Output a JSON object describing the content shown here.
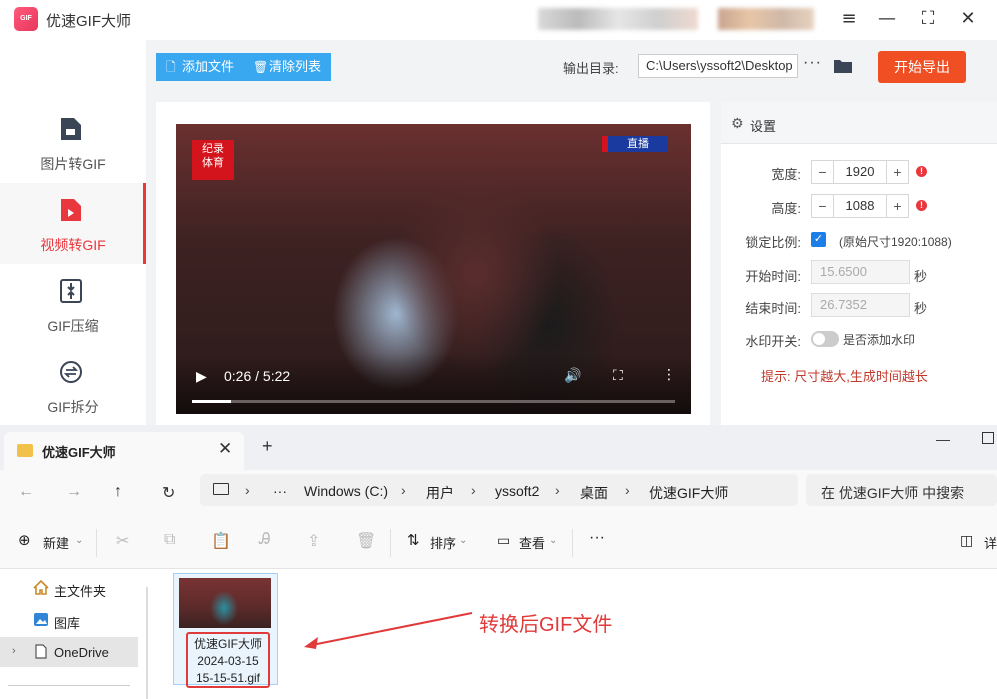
{
  "app": {
    "title": "优速GIF大师",
    "logo_text": "GIF",
    "window_controls": [
      "menu-icon",
      "minimize-icon",
      "maximize-icon",
      "close-icon"
    ],
    "sidebar": {
      "items": [
        {
          "label": "图片转GIF",
          "icon": "image-file-icon",
          "active": false
        },
        {
          "label": "视频转GIF",
          "icon": "video-file-icon",
          "active": true
        },
        {
          "label": "GIF压缩",
          "icon": "compress-icon",
          "active": false
        },
        {
          "label": "GIF拆分",
          "icon": "split-icon",
          "active": false
        }
      ]
    },
    "toolbar": {
      "add_label": "添加文件",
      "clear_label": "清除列表",
      "output_label": "输出目录:",
      "output_path": "C:\\Users\\yssoft2\\Desktop",
      "more": "···",
      "export_label": "开始导出"
    },
    "video": {
      "logo_text": "纪录\n体育",
      "live_badge": "直播",
      "time": "0:26 / 5:22",
      "progress_fraction": 0.081
    },
    "settings": {
      "header": "设置",
      "width_label": "宽度:",
      "width_value": "1920",
      "height_label": "高度:",
      "height_value": "1088",
      "lock_label": "锁定比例:",
      "orig_size": "(原始尺寸1920:1088)",
      "start_label": "开始时间:",
      "start_value": "15.6500",
      "end_label": "结束时间:",
      "end_value": "26.7352",
      "sec_unit": "秒",
      "watermark_label": "水印开关:",
      "watermark_desc": "是否添加水印",
      "tip": "提示: 尺寸越大,生成时间越长"
    }
  },
  "explorer": {
    "tab_title": "优速GIF大师",
    "breadcrumb": [
      "Windows (C:)",
      "用户",
      "yssoft2",
      "桌面",
      "优速GIF大师"
    ],
    "search_placeholder": "在 优速GIF大师 中搜索",
    "commands": {
      "new_label": "新建",
      "sort_label": "排序",
      "view_label": "查看",
      "more": "···",
      "details_label": "详"
    },
    "nav_items": [
      {
        "label": "主文件夹",
        "icon": "home-icon"
      },
      {
        "label": "图库",
        "icon": "gallery-icon"
      },
      {
        "label": "OneDrive",
        "icon": "onedrive-icon",
        "selected": true
      }
    ],
    "file": {
      "name_line1": "优速GIF大师",
      "name_line2": "2024-03-15",
      "name_line3": "15-15-51.gif"
    },
    "annotation": "转换后GIF文件"
  }
}
